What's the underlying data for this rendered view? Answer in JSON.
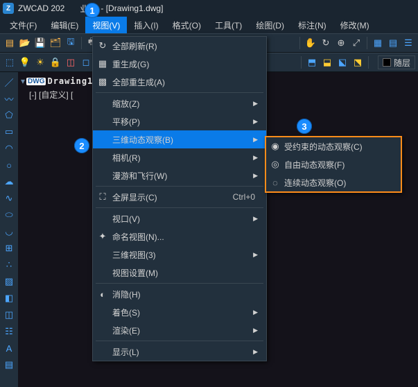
{
  "title": {
    "app": "ZWCAD 202",
    "edition_suffix": "业版",
    "doc": "[Drawing1.dwg]"
  },
  "menubar": [
    {
      "label": "文件(F)"
    },
    {
      "label": "编辑(E)"
    },
    {
      "label": "视图(V)",
      "active": true
    },
    {
      "label": "插入(I)"
    },
    {
      "label": "格式(O)"
    },
    {
      "label": "工具(T)"
    },
    {
      "label": "绘图(D)"
    },
    {
      "label": "标注(N)"
    },
    {
      "label": "修改(M)"
    }
  ],
  "tree": {
    "doc_name": "Drawing1",
    "custom": "[-] [自定义] [",
    "badge": "DWG"
  },
  "layer_box": "随层",
  "dropdown": {
    "items": [
      {
        "icon": "↻",
        "label": "全部刷新(R)"
      },
      {
        "icon": "▦",
        "label": "重生成(G)"
      },
      {
        "icon": "▩",
        "label": "全部重生成(A)"
      },
      {
        "hr": true
      },
      {
        "label": "缩放(Z)",
        "sub": true
      },
      {
        "label": "平移(P)",
        "sub": true
      },
      {
        "label": "三维动态观察(B)",
        "sub": true,
        "hl": true
      },
      {
        "label": "相机(R)",
        "sub": true
      },
      {
        "label": "漫游和飞行(W)",
        "sub": true
      },
      {
        "hr": true
      },
      {
        "icon": "⛶",
        "label": "全屏显示(C)",
        "shortcut": "Ctrl+0"
      },
      {
        "hr": true
      },
      {
        "label": "视口(V)",
        "sub": true
      },
      {
        "icon": "✦",
        "label": "命名视图(N)..."
      },
      {
        "label": "三维视图(3)",
        "sub": true
      },
      {
        "label": "视图设置(M)"
      },
      {
        "hr": true
      },
      {
        "icon": "◐",
        "label": "消隐(H)"
      },
      {
        "label": "着色(S)",
        "sub": true
      },
      {
        "label": "渲染(E)",
        "sub": true
      },
      {
        "hr": true
      },
      {
        "label": "显示(L)",
        "sub": true
      }
    ]
  },
  "submenu": {
    "items": [
      {
        "icon": "◉",
        "label": "受约束的动态观察(C)"
      },
      {
        "icon": "◎",
        "label": "自由动态观察(F)"
      },
      {
        "icon": "◌",
        "label": "连续动态观察(O)"
      }
    ]
  },
  "callouts": {
    "c1": "1",
    "c2": "2",
    "c3": "3"
  }
}
